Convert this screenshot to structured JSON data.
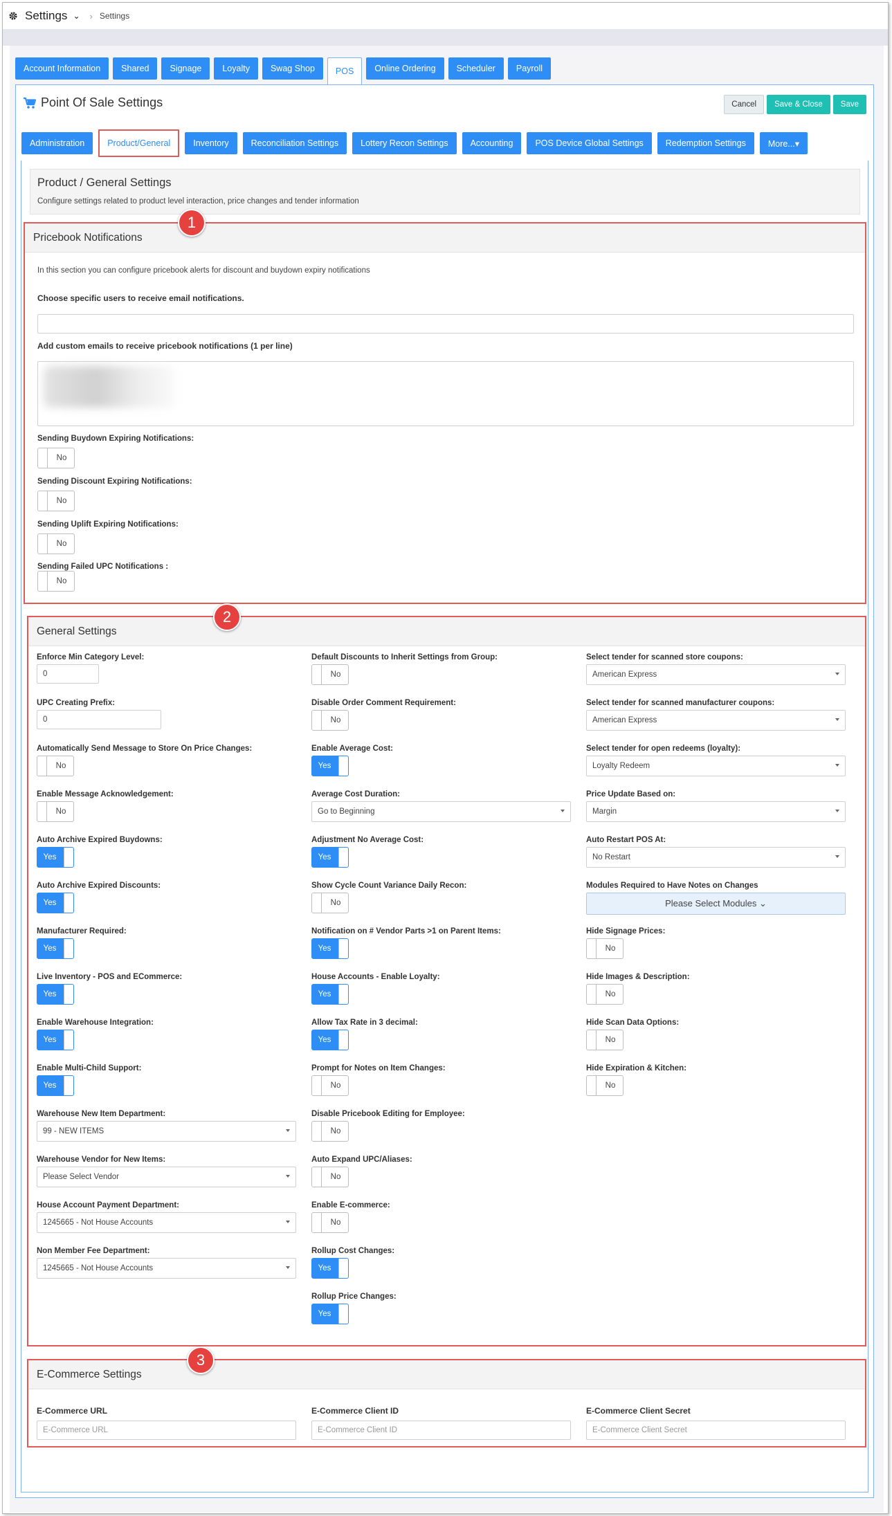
{
  "topbar": {
    "title": "Settings",
    "breadcrumb": "Settings"
  },
  "tabs_top": [
    {
      "label": "Account Information"
    },
    {
      "label": "Shared"
    },
    {
      "label": "Signage"
    },
    {
      "label": "Loyalty"
    },
    {
      "label": "Swag Shop"
    },
    {
      "label": "POS",
      "active": true
    },
    {
      "label": "Online Ordering"
    },
    {
      "label": "Scheduler"
    },
    {
      "label": "Payroll"
    }
  ],
  "panel": {
    "title": "Point Of Sale Settings",
    "cancel": "Cancel",
    "save_close": "Save & Close",
    "save": "Save"
  },
  "tabs_pos": [
    {
      "label": "Administration"
    },
    {
      "label": "Product/General",
      "active": true
    },
    {
      "label": "Inventory"
    },
    {
      "label": "Reconciliation Settings"
    },
    {
      "label": "Lottery Recon Settings"
    },
    {
      "label": "Accounting"
    },
    {
      "label": "POS Device Global Settings"
    },
    {
      "label": "Redemption Settings"
    },
    {
      "label": "More...▾"
    }
  ],
  "info": {
    "title": "Product / General Settings",
    "desc": "Configure settings related to product level interaction, price changes and tender information"
  },
  "badges": [
    "1",
    "2",
    "3"
  ],
  "pricebook": {
    "title": "Pricebook Notifications",
    "desc": "In this section you can configure pricebook alerts for discount and buydown expiry notifications",
    "users_label": "Choose specific users to receive email notifications.",
    "emails_label": "Add custom emails to receive pricebook notifications (1 per line)",
    "toggles": [
      {
        "label": "Sending Buydown Expiring Notifications:",
        "value": "No"
      },
      {
        "label": "Sending Discount Expiring Notifications:",
        "value": "No"
      },
      {
        "label": "Sending Uplift Expiring Notifications:",
        "value": "No"
      },
      {
        "label": "Sending Failed UPC Notifications :",
        "value": "No"
      }
    ]
  },
  "general": {
    "title": "General Settings",
    "col1": [
      {
        "label": "Enforce Min Category Level:",
        "type": "input",
        "value": "0"
      },
      {
        "label": "UPC Creating Prefix:",
        "type": "input",
        "value": "0"
      },
      {
        "label": "Automatically Send Message to Store On Price Changes:",
        "type": "toggle",
        "value": "No"
      },
      {
        "label": "Enable Message Acknowledgement:",
        "type": "toggle",
        "value": "No"
      },
      {
        "label": "Auto Archive Expired Buydowns:",
        "type": "toggle",
        "value": "Yes"
      },
      {
        "label": "Auto Archive Expired Discounts:",
        "type": "toggle",
        "value": "Yes"
      },
      {
        "label": "Manufacturer Required:",
        "type": "toggle",
        "value": "Yes"
      },
      {
        "label": "Live Inventory - POS and ECommerce:",
        "type": "toggle",
        "value": "Yes"
      },
      {
        "label": "Enable Warehouse Integration:",
        "type": "toggle",
        "value": "Yes"
      },
      {
        "label": "Enable Multi-Child Support:",
        "type": "toggle",
        "value": "Yes"
      },
      {
        "label": "Warehouse New Item Department:",
        "type": "select",
        "value": "99 - NEW ITEMS"
      },
      {
        "label": "Warehouse Vendor for New Items:",
        "type": "select",
        "value": "Please Select Vendor"
      },
      {
        "label": "House Account Payment Department:",
        "type": "select",
        "value": "1245665 - Not House Accounts"
      },
      {
        "label": "Non Member Fee Department:",
        "type": "select",
        "value": "1245665 - Not House Accounts"
      }
    ],
    "col2": [
      {
        "label": "Default Discounts to Inherit Settings from Group:",
        "type": "toggle",
        "value": "No"
      },
      {
        "label": "Disable Order Comment Requirement:",
        "type": "toggle",
        "value": "No"
      },
      {
        "label": "Enable Average Cost:",
        "type": "toggle",
        "value": "Yes"
      },
      {
        "label": "Average Cost Duration:",
        "type": "select",
        "value": "Go to Beginning"
      },
      {
        "label": "Adjustment No Average Cost:",
        "type": "toggle",
        "value": "Yes"
      },
      {
        "label": "Show Cycle Count Variance Daily Recon:",
        "type": "toggle",
        "value": "No"
      },
      {
        "label": "Notification on # Vendor Parts >1 on Parent Items:",
        "type": "toggle",
        "value": "Yes"
      },
      {
        "label": "House Accounts - Enable Loyalty:",
        "type": "toggle",
        "value": "Yes"
      },
      {
        "label": "Allow Tax Rate in 3 decimal:",
        "type": "toggle",
        "value": "Yes"
      },
      {
        "label": "Prompt for Notes on Item Changes:",
        "type": "toggle",
        "value": "No"
      },
      {
        "label": "Disable Pricebook Editing for Employee:",
        "type": "toggle",
        "value": "No"
      },
      {
        "label": "Auto Expand UPC/Aliases:",
        "type": "toggle",
        "value": "No"
      },
      {
        "label": "Enable E-commerce:",
        "type": "toggle",
        "value": "No"
      },
      {
        "label": "Rollup Cost Changes:",
        "type": "toggle",
        "value": "Yes"
      },
      {
        "label": "Rollup Price Changes:",
        "type": "toggle",
        "value": "Yes"
      }
    ],
    "col3": [
      {
        "label": "Select tender for scanned store coupons:",
        "type": "select",
        "value": "American Express"
      },
      {
        "label": "Select tender for scanned manufacturer coupons:",
        "type": "select",
        "value": "American Express"
      },
      {
        "label": "Select tender for open redeems (loyalty):",
        "type": "select",
        "value": "Loyalty Redeem"
      },
      {
        "label": "Price Update Based on:",
        "type": "select",
        "value": "Margin"
      },
      {
        "label": "Auto Restart POS At:",
        "type": "select",
        "value": "No Restart"
      },
      {
        "label": "Modules Required to Have Notes on Changes",
        "type": "modules",
        "value": "Please Select Modules ⌄"
      },
      {
        "label": "Hide Signage Prices:",
        "type": "toggle",
        "value": "No"
      },
      {
        "label": "Hide Images & Description:",
        "type": "toggle",
        "value": "No"
      },
      {
        "label": "Hide Scan Data Options:",
        "type": "toggle",
        "value": "No"
      },
      {
        "label": "Hide Expiration & Kitchen:",
        "type": "toggle",
        "value": "No"
      }
    ]
  },
  "ecommerce": {
    "title": "E-Commerce Settings",
    "fields": [
      {
        "label": "E-Commerce URL",
        "placeholder": "E-Commerce URL"
      },
      {
        "label": "E-Commerce Client ID",
        "placeholder": "E-Commerce Client ID"
      },
      {
        "label": "E-Commerce Client Secret",
        "placeholder": "E-Commerce Client Secret"
      }
    ]
  }
}
